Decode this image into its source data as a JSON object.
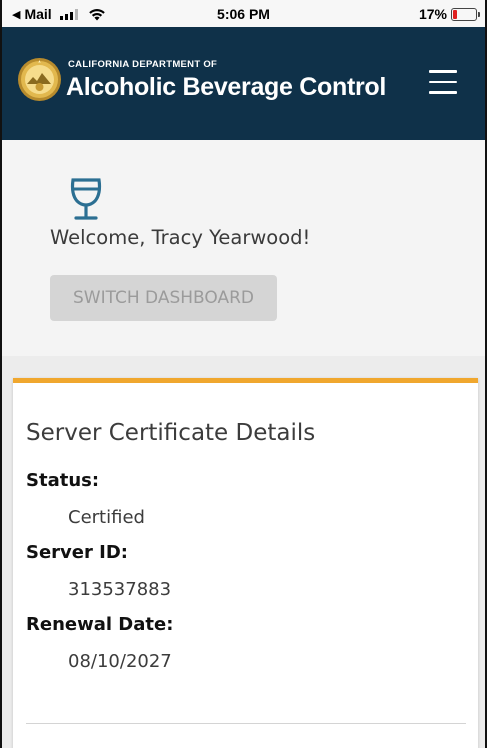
{
  "status_bar": {
    "back_app": "Mail",
    "time": "5:06 PM",
    "battery_percent": "17%",
    "battery_level": 0.17
  },
  "header": {
    "org_small": "CALIFORNIA DEPARTMENT OF",
    "org_big": "Alcoholic Beverage Control",
    "seal_icon": "state-seal-icon",
    "menu_icon": "hamburger-menu-icon",
    "background_color": "#0f3149"
  },
  "welcome": {
    "icon": "wine-glass-icon",
    "greeting": "Welcome, Tracy Yearwood!",
    "switch_button_label": "SWITCH DASHBOARD"
  },
  "certificate": {
    "title": "Server Certificate Details",
    "accent_color": "#f0a72e",
    "fields": [
      {
        "label": "Status:",
        "value": "Certified"
      },
      {
        "label": "Server ID:",
        "value": "313537883"
      },
      {
        "label": "Renewal Date:",
        "value": "08/10/2027"
      }
    ]
  }
}
